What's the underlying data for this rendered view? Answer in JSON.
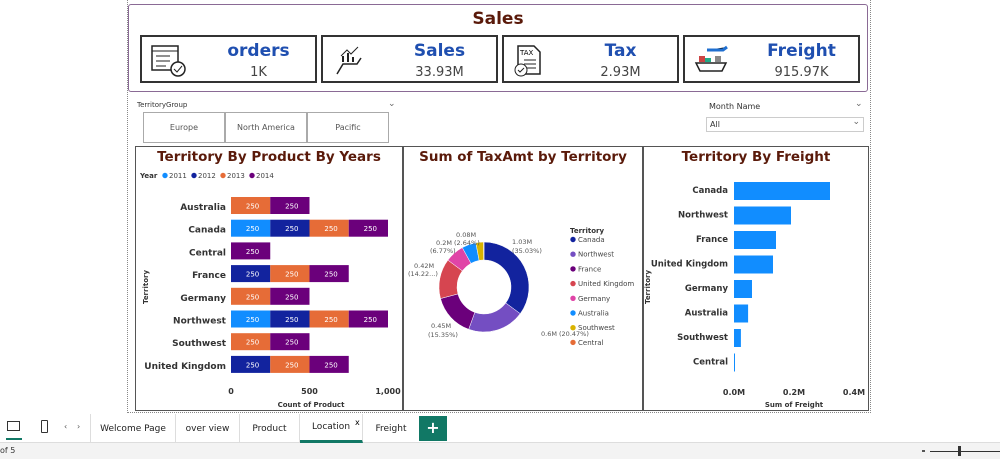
{
  "header": {
    "title": "Sales"
  },
  "kpis": [
    {
      "label": "orders",
      "value": "1K",
      "icon": "order-checklist-icon"
    },
    {
      "label": "Sales",
      "value": "33.93M",
      "icon": "sales-growth-hand-icon"
    },
    {
      "label": "Tax",
      "value": "2.93M",
      "icon": "tax-document-icon"
    },
    {
      "label": "Freight",
      "value": "915.97K",
      "icon": "freight-ship-plane-icon"
    }
  ],
  "territory_slicer": {
    "label": "TerritoryGroup",
    "options": [
      "Europe",
      "North America",
      "Pacific"
    ]
  },
  "month_slicer": {
    "label": "Month Name",
    "value": "All"
  },
  "chart_data": [
    {
      "type": "bar",
      "orientation": "horizontal",
      "stacked": true,
      "title": "Territory By Product By Years",
      "legend_title": "Year",
      "legend_position": "top-left",
      "categories": [
        "Australia",
        "Canada",
        "Central",
        "France",
        "Germany",
        "Northwest",
        "Southwest",
        "United Kingdom"
      ],
      "series": [
        {
          "name": "2011",
          "color": "#118dff",
          "values": [
            0,
            250,
            0,
            0,
            0,
            250,
            0,
            0
          ]
        },
        {
          "name": "2012",
          "color": "#12239e",
          "values": [
            0,
            250,
            0,
            250,
            0,
            250,
            0,
            250
          ]
        },
        {
          "name": "2013",
          "color": "#e66c37",
          "values": [
            250,
            250,
            0,
            250,
            250,
            250,
            250,
            250
          ]
        },
        {
          "name": "2014",
          "color": "#6b007b",
          "values": [
            250,
            250,
            250,
            250,
            250,
            250,
            250,
            250
          ]
        }
      ],
      "xlabel": "Count of Product",
      "ylabel": "Territory",
      "xlim": [
        0,
        1000
      ],
      "xticks": [
        "0",
        "500",
        "1,000"
      ]
    },
    {
      "type": "pie",
      "donut": true,
      "title": "Sum of TaxAmt by Territory",
      "legend_title": "Territory",
      "legend_position": "right",
      "slices": [
        {
          "label": "Canada",
          "value": 1.03,
          "text": "1.03M",
          "pct": "(35.03%)",
          "color": "#12239e"
        },
        {
          "label": "Northwest",
          "value": 0.6,
          "text": "0.6M (20.47%)",
          "pct": "",
          "color": "#744ec2"
        },
        {
          "label": "France",
          "value": 0.45,
          "text": "0.45M",
          "pct": "(15.35%)",
          "color": "#6b007b"
        },
        {
          "label": "United Kingdom",
          "value": 0.42,
          "text": "0.42M",
          "pct": "(14.22...)",
          "color": "#d64550"
        },
        {
          "label": "Germany",
          "value": 0.2,
          "text": "0.2M (2.64%)",
          "pct": "(6.77%)",
          "color": "#e044a7"
        },
        {
          "label": "Australia",
          "value": 0.15,
          "text": "",
          "pct": "",
          "color": "#118dff"
        },
        {
          "label": "Southwest",
          "value": 0.08,
          "text": "0.08M",
          "pct": "",
          "color": "#d9b300"
        },
        {
          "label": "Central",
          "value": 0.005,
          "text": "",
          "pct": "",
          "color": "#e66c37"
        }
      ]
    },
    {
      "type": "bar",
      "orientation": "horizontal",
      "title": "Territory By Freight",
      "color": "#118dff",
      "categories": [
        "Canada",
        "Northwest",
        "France",
        "United Kingdom",
        "Germany",
        "Australia",
        "Southwest",
        "Central"
      ],
      "values": [
        0.32,
        0.19,
        0.14,
        0.13,
        0.06,
        0.047,
        0.023,
        0.001
      ],
      "xlabel": "Sum of Freight",
      "ylabel": "Territory",
      "xlim": [
        0,
        0.4
      ],
      "xticks": [
        "0.0M",
        "0.2M",
        "0.4M"
      ],
      "unit": "M"
    }
  ],
  "tabs": [
    {
      "label": "Welcome Page"
    },
    {
      "label": "over view"
    },
    {
      "label": "Product"
    },
    {
      "label": "Location",
      "active": true
    },
    {
      "label": "Freight"
    }
  ],
  "add_tab": "+",
  "close_tab": "x",
  "status": {
    "page": "of 5"
  }
}
